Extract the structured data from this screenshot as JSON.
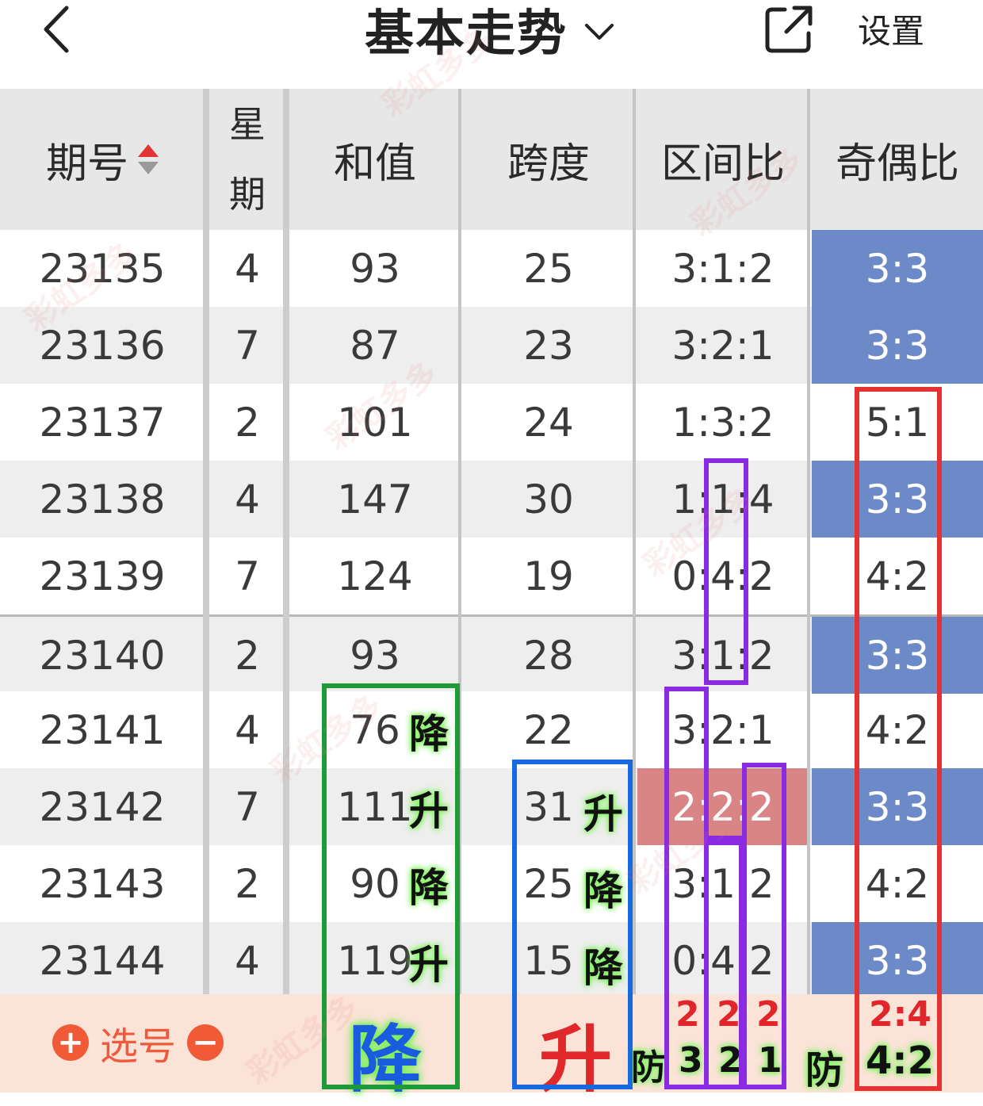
{
  "topbar": {
    "back_icon": "chevron-left-icon",
    "title": "基本走势",
    "title_dropdown_icon": "chevron-down-icon",
    "share_icon": "share-icon",
    "settings_label": "设置"
  },
  "table": {
    "headers": {
      "issue": "期号",
      "week_top": "星",
      "week_bottom": "期",
      "sum": "和值",
      "span": "跨度",
      "zone_ratio": "区间比",
      "odd_even": "奇偶比"
    },
    "rows": [
      {
        "issue": "23135",
        "week": "4",
        "sum": "93",
        "span": "25",
        "zone": "3:1:2",
        "oe": "3:3"
      },
      {
        "issue": "23136",
        "week": "7",
        "sum": "87",
        "span": "23",
        "zone": "3:2:1",
        "oe": "3:3"
      },
      {
        "issue": "23137",
        "week": "2",
        "sum": "101",
        "span": "24",
        "zone": "1:3:2",
        "oe": "5:1"
      },
      {
        "issue": "23138",
        "week": "4",
        "sum": "147",
        "span": "30",
        "zone": "1:1:4",
        "oe": "3:3"
      },
      {
        "issue": "23139",
        "week": "7",
        "sum": "124",
        "span": "19",
        "zone": "0:4:2",
        "oe": "4:2"
      },
      {
        "issue": "23140",
        "week": "2",
        "sum": "93",
        "span": "28",
        "zone": "3:1:2",
        "oe": "3:3"
      },
      {
        "issue": "23141",
        "week": "4",
        "sum": "76",
        "span": "22",
        "zone": "3:2:1",
        "oe": "4:2"
      },
      {
        "issue": "23142",
        "week": "7",
        "sum": "111",
        "span": "31",
        "zone": "2:2:2",
        "oe": "3:3"
      },
      {
        "issue": "23143",
        "week": "2",
        "sum": "90",
        "span": "25",
        "zone": "3:1:2",
        "oe": "4:2"
      },
      {
        "issue": "23144",
        "week": "4",
        "sum": "119",
        "span": "15",
        "zone": "0:4:2",
        "oe": "3:3"
      }
    ]
  },
  "annotations": {
    "sum_marks": [
      "降",
      "升",
      "降",
      "升"
    ],
    "span_marks": [
      "升",
      "降",
      "降"
    ],
    "sum_prediction": "降",
    "span_prediction": "升",
    "zone_pred_top": [
      "2",
      "2",
      "2"
    ],
    "zone_guard_label": "防",
    "zone_pred_bottom": [
      "3",
      "2",
      "1"
    ],
    "oe_guard_label": "防",
    "oe_pred_top": "2:4",
    "oe_pred_bottom": "4:2"
  },
  "footer": {
    "add_icon": "plus-circle-icon",
    "pick_label": "选号",
    "remove_icon": "minus-circle-icon"
  },
  "watermark": "彩虹多多",
  "colors": {
    "oe_blue": "#6c8ac7",
    "zone_highlight": "#d98585",
    "footer_bg": "#fbe3d8",
    "accent_red": "#e23434"
  }
}
